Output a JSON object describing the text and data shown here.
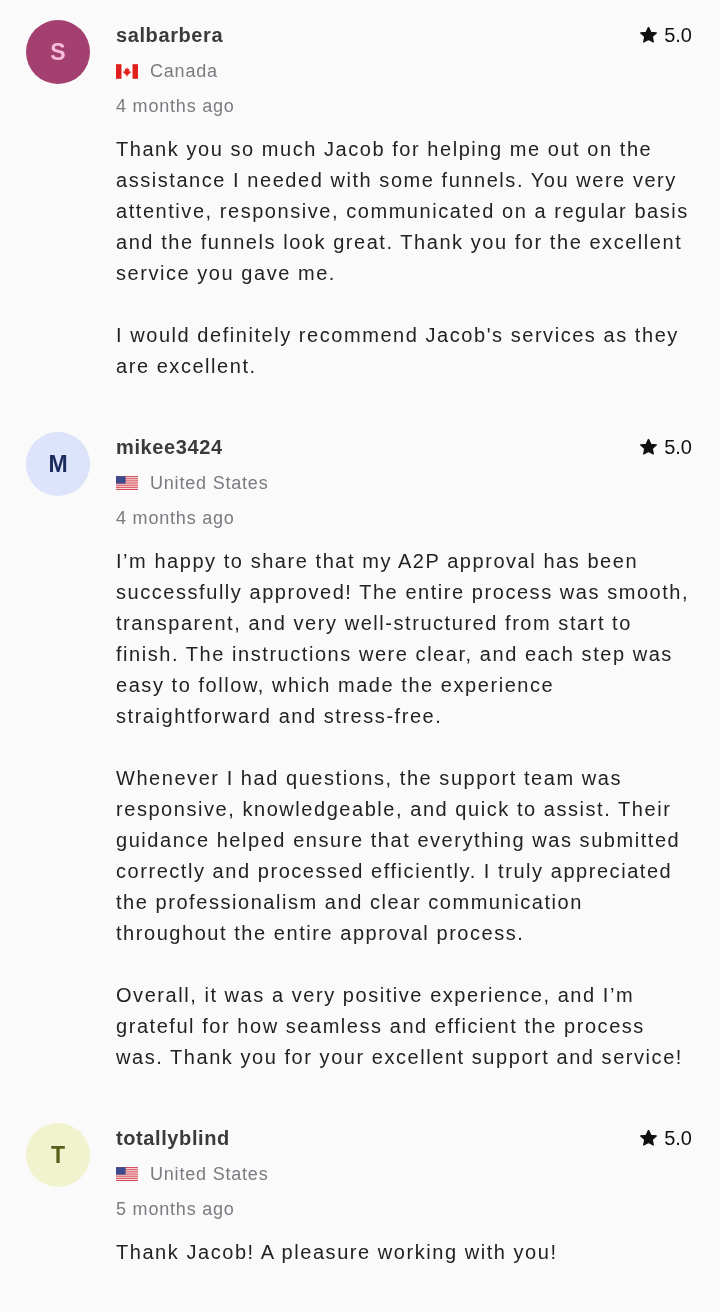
{
  "reviews": [
    {
      "avatar": {
        "letter": "S",
        "color": "#a3406f"
      },
      "username": "salbarbera",
      "rating": "5.0",
      "country": {
        "kind": "ca",
        "name": "Canada"
      },
      "time": "4 months ago",
      "paragraphs": [
        "Thank you so much Jacob for helping me out on the assistance I needed with some funnels. You were very attentive, responsive, communicated on a regular basis and the funnels look great. Thank you for the excellent service you gave me.",
        "I would definitely recommend Jacob's services as they are excellent."
      ]
    },
    {
      "avatar": {
        "letter": "M",
        "color": "#dce3fa"
      },
      "username": "mikee3424",
      "rating": "5.0",
      "country": {
        "kind": "us",
        "name": "United States"
      },
      "time": "4 months ago",
      "paragraphs": [
        "I’m happy to share that my A2P approval has been successfully approved! The entire process was smooth, transparent, and very well-structured from start to finish. The instructions were clear, and each step was easy to follow, which made the experience straightforward and stress-free.",
        "Whenever I had questions, the support team was responsive, knowledgeable, and quick to assist. Their guidance helped ensure that everything was submitted correctly and processed efficiently. I truly appreciated the professionalism and clear communication throughout the entire approval process.",
        "Overall, it was a very positive experience, and I’m grateful for how seamless and efficient the process was. Thank you for your excellent support and service!"
      ]
    },
    {
      "avatar": {
        "letter": "T",
        "color": "#f1f3cf"
      },
      "username": "totallyblind",
      "rating": "5.0",
      "country": {
        "kind": "us",
        "name": "United States"
      },
      "time": "5 months ago",
      "paragraphs": [
        "Thank Jacob! A pleasure working with you!"
      ]
    }
  ]
}
